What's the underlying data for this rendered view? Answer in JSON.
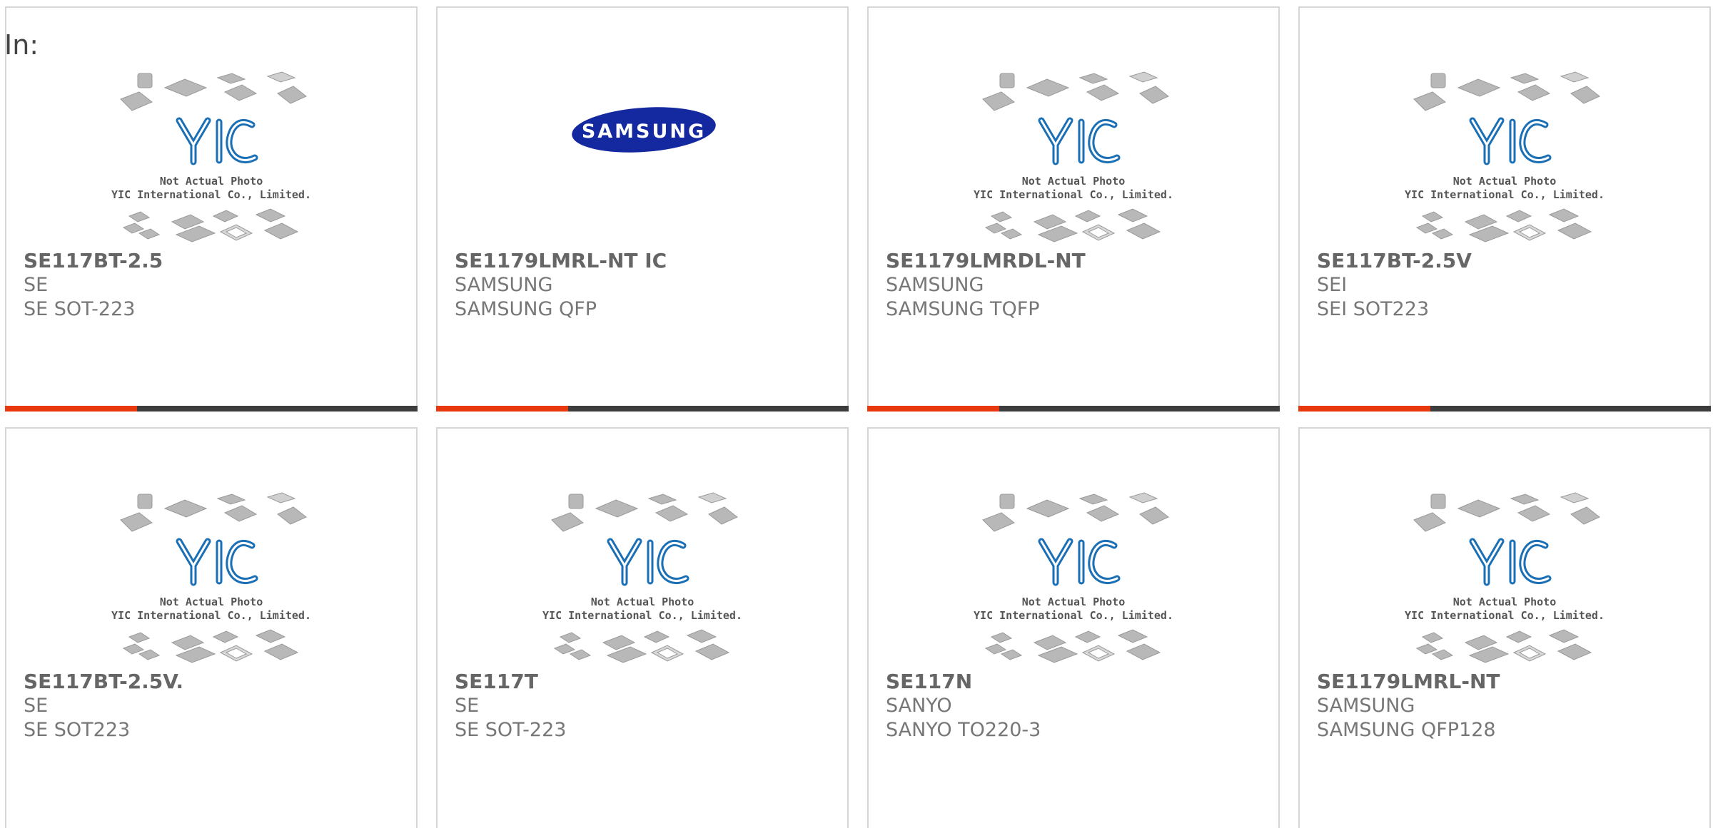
{
  "header": {
    "prefix": "In:"
  },
  "placeholder": {
    "line1": "Not Actual Photo",
    "line2": "YIC International Co., Limited.",
    "logo_text": "YIC"
  },
  "samsung_logo_text": "SAMSUNG",
  "colors": {
    "accent": "#e8380d",
    "track": "#3d3d3d",
    "yic_blue": "#1a6fb5",
    "samsung_blue": "#1428a0",
    "chip_gray": "#b8b8b8",
    "text": "#666666"
  },
  "products": [
    {
      "name": "SE117BT-2.5",
      "brand": "SE",
      "package": "SE SOT-223",
      "image": "yic-placeholder",
      "progress": 0.32
    },
    {
      "name": "SE1179LMRL-NT IC",
      "brand": "SAMSUNG",
      "package": "SAMSUNG QFP",
      "image": "samsung-logo",
      "progress": 0.32
    },
    {
      "name": "SE1179LMRDL-NT",
      "brand": "SAMSUNG",
      "package": "SAMSUNG TQFP",
      "image": "yic-placeholder",
      "progress": 0.32
    },
    {
      "name": "SE117BT-2.5V",
      "brand": "SEI",
      "package": "SEI SOT223",
      "image": "yic-placeholder",
      "progress": 0.32
    },
    {
      "name": "SE117BT-2.5V.",
      "brand": "SE",
      "package": "SE SOT223",
      "image": "yic-placeholder"
    },
    {
      "name": "SE117T",
      "brand": "SE",
      "package": "SE SOT-223",
      "image": "yic-placeholder"
    },
    {
      "name": "SE117N",
      "brand": "SANYO",
      "package": "SANYO TO220-3",
      "image": "yic-placeholder"
    },
    {
      "name": "SE1179LMRL-NT",
      "brand": "SAMSUNG",
      "package": "SAMSUNG QFP128",
      "image": "yic-placeholder"
    }
  ]
}
